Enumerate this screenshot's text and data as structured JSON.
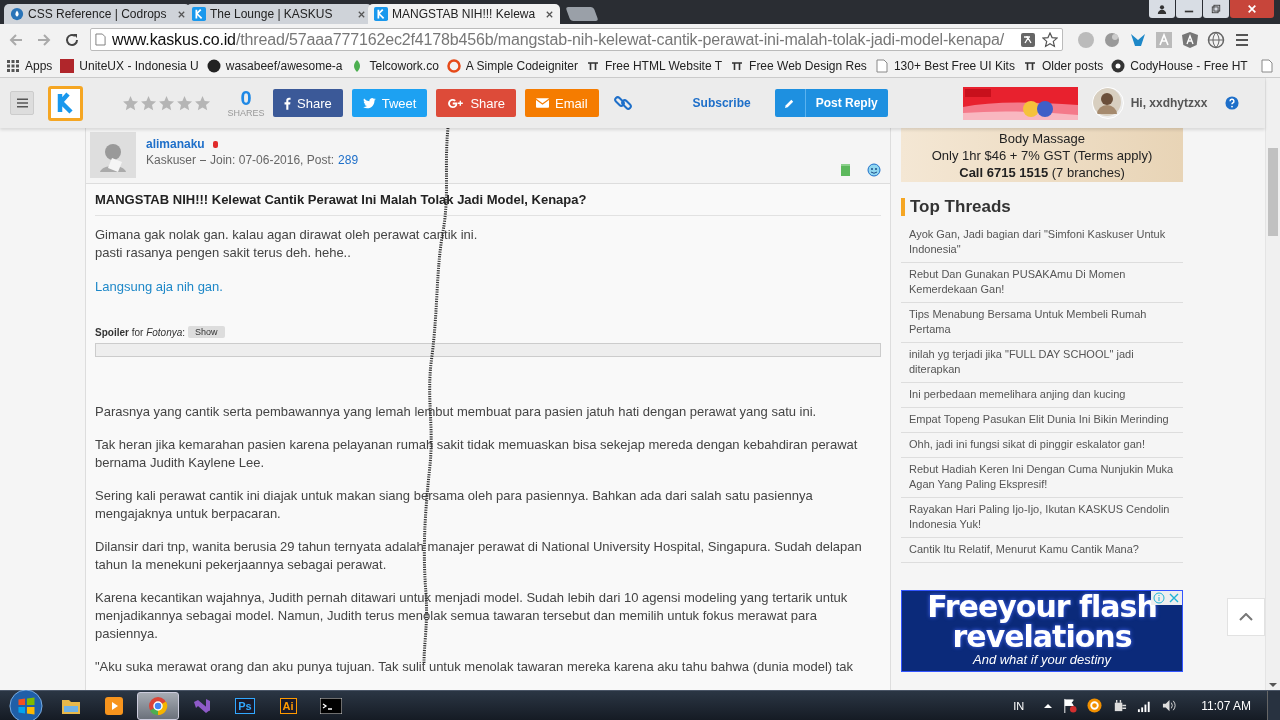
{
  "browser": {
    "tabs": [
      {
        "title": "CSS Reference | Codrops",
        "kind": "drop",
        "selected": false
      },
      {
        "title": "The Lounge | KASKUS",
        "kind": "kaskus",
        "selected": false
      },
      {
        "title": "MANGSTAB NIH!!! Kelewa",
        "kind": "kaskus",
        "selected": true
      }
    ],
    "address": {
      "domain": "www.kaskus.co.id",
      "path": "/thread/57aaa777162ec2f4178b456b/mangstab-nih-kelewat-cantik-perawat-ini-malah-tolak-jadi-model-kenapa/"
    },
    "bookmarks": [
      {
        "label": "Apps",
        "kind": "apps"
      },
      {
        "label": "UniteUX - Indonesia U",
        "kind": "ux"
      },
      {
        "label": "wasabeef/awesome-a",
        "kind": "github"
      },
      {
        "label": "Telcowork.co",
        "kind": "leaf"
      },
      {
        "label": "A Simple Codeigniter",
        "kind": "flame"
      },
      {
        "label": "Free HTML Website T",
        "kind": "tt"
      },
      {
        "label": "Free Web Design Res",
        "kind": "tt"
      },
      {
        "label": "130+ Best Free UI Kits",
        "kind": "page"
      },
      {
        "label": "Older posts",
        "kind": "tt"
      },
      {
        "label": "CodyHouse - Free HT",
        "kind": "cody"
      }
    ]
  },
  "header": {
    "stars": 0,
    "share_count": "0",
    "share_caption": "SHARES",
    "share_buttons": [
      {
        "label": "Share",
        "kind": "facebook"
      },
      {
        "label": "Tweet",
        "kind": "twitter"
      },
      {
        "label": "Share",
        "kind": "google"
      },
      {
        "label": "Email",
        "kind": "email"
      }
    ],
    "subscribe": "Subscribe",
    "post_reply": "Post Reply",
    "greeting": "Hi, xxdhytzxx"
  },
  "post": {
    "author": {
      "name": "alimanaku",
      "rank": "Kaskuser",
      "joined": "Join: 07-06-2016, Post:",
      "posts": "289"
    },
    "title": "MANGSTAB NIH!!! Kelewat Cantik Perawat Ini Malah Tolak Jadi Model, Kenapa?",
    "intro": [
      "Gimana gak nolak gan. kalau agan dirawat oleh perawat cantik ini.",
      "pasti rasanya pengen sakit terus deh. hehe.."
    ],
    "link": "Langsung aja nih gan.",
    "spoiler": {
      "label": "**Spoiler** for *Fotonya*:",
      "button": "Show",
      "expanded": false
    },
    "paragraphs": [
      "Parasnya yang cantik serta pembawannya yang lemah lembut membuat para pasien jatuh hati dengan perawat yang satu ini.",
      "Tak heran jika kemarahan pasien karena pelayanan rumah sakit tidak memuaskan bisa sekejap mereda dengan kebahdiran perawat bernama Judith Kaylene Lee.",
      "Sering kali perawat cantik ini diajak untuk makan siang bersama oleh para pasiennya. Bahkan ada dari salah satu pasiennya mengajaknya untuk berpacaran.",
      "Dilansir dari tnp, wanita berusia 29 tahun ternyata adalah manajer perawat di National University Hospital, Singapura. Sudah delapan tahun Ia menekuni pekerjaannya sebagai perawat.",
      "Karena kecantikan wajahnya, Judith pernah ditawari untuk menjadi model. Sudah lebih dari 10 agensi modeling yang tertarik untuk menjadikannya sebagai model. Namun, Judith terus menolak semua tawaran tersebut dan memilih untuk fokus merawat para pasiennya.",
      "\"Aku suka merawat orang dan aku punya tujuan. Tak sulit untuk menolak tawaran mereka karena aku tahu bahwa (dunia model) tak"
    ]
  },
  "sidebar": {
    "ad": [
      "Body Massage",
      "Only 1hr $46 + 7% GST (Terms apply)",
      "**Call 6715 1515** (7 branches)"
    ],
    "heading": "Top Threads",
    "threads": [
      "Ayok Gan, Jadi bagian dari \"Simfoni Kaskuser Untuk Indonesia\"",
      "Rebut Dan Gunakan PUSAKAmu Di Momen Kemerdekaan Gan!",
      "Tips Menabung Bersama Untuk Membeli Rumah Pertama",
      "inilah yg terjadi jika \"FULL DAY SCHOOL\" jadi diterapkan",
      "Ini perbedaan memelihara anjing dan kucing",
      "Empat Topeng Pasukan Elit Dunia Ini Bikin Merinding",
      "Ohh, jadi ini fungsi sikat di pinggir eskalator gan!",
      "Rebut Hadiah Keren Ini Dengan Cuma Nunjukin Muka Agan Yang Paling Ekspresif!",
      "Rayakan Hari Paling Ijo-Ijo, Ikutan KASKUS Cendolin Indonesia Yuk!",
      "Cantik Itu Relatif, Menurut Kamu Cantik Mana?"
    ],
    "banner": [
      "Freeyour flash",
      "revelations",
      "And what if your destiny"
    ]
  },
  "taskbar": {
    "apps": [
      {
        "kind": "explorer",
        "selected": false
      },
      {
        "kind": "media",
        "selected": false
      },
      {
        "kind": "chrome",
        "selected": true
      },
      {
        "kind": "vs",
        "selected": false
      },
      {
        "kind": "ps",
        "label": "Ps",
        "selected": false
      },
      {
        "kind": "ai",
        "label": "Ai",
        "selected": false
      },
      {
        "kind": "cmd",
        "selected": false
      }
    ],
    "language": "IN",
    "clock": "11:07 AM"
  }
}
